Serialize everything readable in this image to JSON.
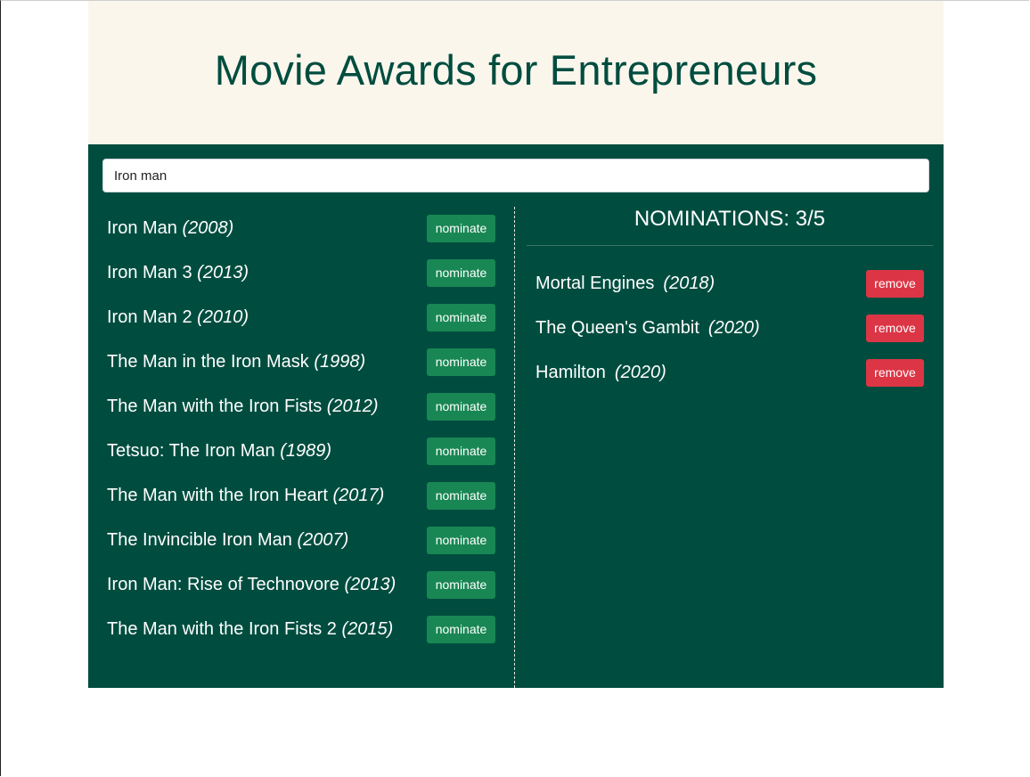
{
  "header": {
    "title": "Movie Awards for Entrepreneurs"
  },
  "search": {
    "value": "Iron man",
    "placeholder": ""
  },
  "colors": {
    "header_bg": "#fbf6ec",
    "brand_green": "#004d3f",
    "nominate_button": "#198754",
    "remove_button": "#dc3545"
  },
  "results": {
    "button_label": "nominate",
    "items": [
      {
        "title": "Iron Man",
        "year": "(2008)"
      },
      {
        "title": "Iron Man 3",
        "year": "(2013)"
      },
      {
        "title": "Iron Man 2",
        "year": "(2010)"
      },
      {
        "title": "The Man in the Iron Mask",
        "year": "(1998)"
      },
      {
        "title": "The Man with the Iron Fists",
        "year": "(2012)"
      },
      {
        "title": "Tetsuo: The Iron Man",
        "year": "(1989)"
      },
      {
        "title": "The Man with the Iron Heart",
        "year": "(2017)"
      },
      {
        "title": "The Invincible Iron Man",
        "year": "(2007)"
      },
      {
        "title": "Iron Man: Rise of Technovore",
        "year": "(2013)"
      },
      {
        "title": "The Man with the Iron Fists 2",
        "year": "(2015)"
      }
    ]
  },
  "nominations": {
    "heading": "NOMINATIONS: 3/5",
    "button_label": "remove",
    "items": [
      {
        "title": "Mortal Engines",
        "year": "(2018)"
      },
      {
        "title": "The Queen's Gambit",
        "year": "(2020)"
      },
      {
        "title": "Hamilton",
        "year": "(2020)"
      }
    ]
  }
}
